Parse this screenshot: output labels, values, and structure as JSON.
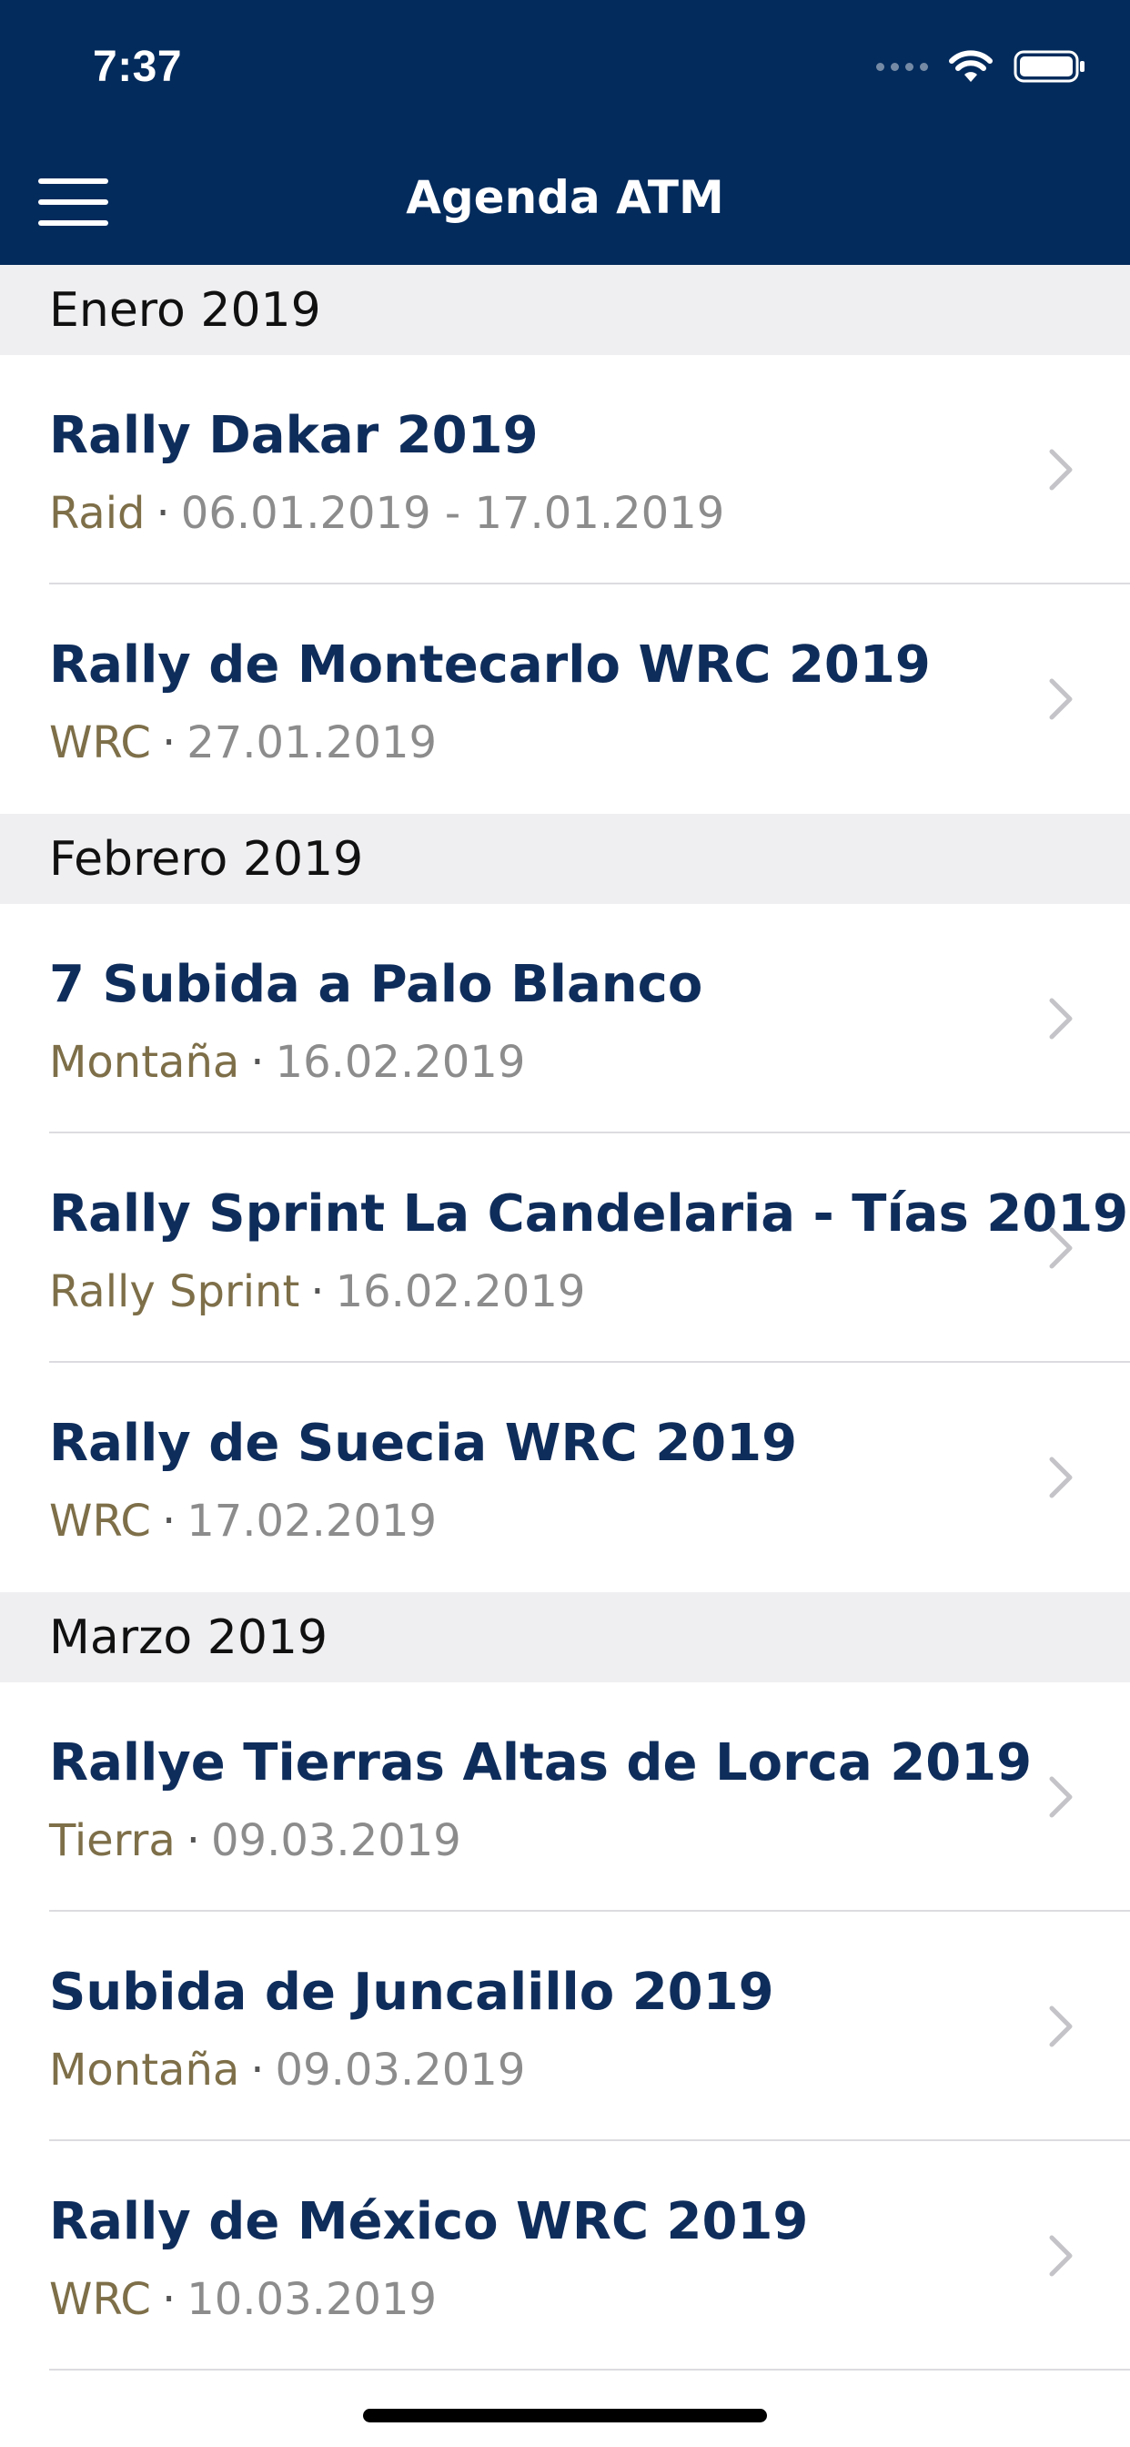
{
  "status_bar": {
    "time": "7:37"
  },
  "nav": {
    "title": "Agenda ATM",
    "menu_icon": "hamburger-menu-icon"
  },
  "colors": {
    "navbar": "#032b5c",
    "title_text": "#0f2d5b",
    "category_text": "#7e6f49",
    "date_text": "#8c8c8c",
    "section_bg": "#efeff2"
  },
  "sections": [
    {
      "header": "Enero 2019",
      "events": [
        {
          "title": "Rally Dakar 2019",
          "category": "Raid",
          "date": "06.01.2019 - 17.01.2019"
        },
        {
          "title": "Rally de Montecarlo WRC 2019",
          "category": "WRC",
          "date": "27.01.2019"
        }
      ]
    },
    {
      "header": "Febrero 2019",
      "events": [
        {
          "title": "7 Subida a Palo Blanco",
          "category": "Montaña",
          "date": "16.02.2019"
        },
        {
          "title": "Rally Sprint La Candelaria - Tías 2019",
          "category": "Rally Sprint",
          "date": "16.02.2019"
        },
        {
          "title": "Rally de Suecia WRC 2019",
          "category": "WRC",
          "date": "17.02.2019"
        }
      ]
    },
    {
      "header": "Marzo 2019",
      "events": [
        {
          "title": "Rallye Tierras Altas de Lorca 2019",
          "category": "Tierra",
          "date": "09.03.2019"
        },
        {
          "title": "Subida de Juncalillo 2019",
          "category": "Montaña",
          "date": "09.03.2019"
        },
        {
          "title": "Rally de México WRC 2019",
          "category": "WRC",
          "date": "10.03.2019"
        }
      ]
    }
  ],
  "separator": "·"
}
